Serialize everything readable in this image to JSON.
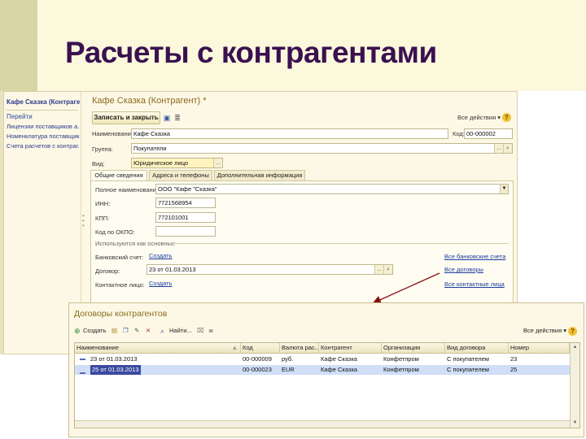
{
  "slide": {
    "title": "Расчеты с контрагентами"
  },
  "nav": {
    "title": "Кафе Сказка (Контрагент)",
    "go_label": "Перейти",
    "links": [
      "Лицензии поставщиков а...",
      "Номенклатура поставщика",
      "Счета расчетов с контраг..."
    ]
  },
  "form": {
    "title": "Кафе Сказка (Контрагент) *",
    "save_close_label": "Записать и закрыть",
    "all_actions_label": "Все действия ▾",
    "help_label": "?",
    "name_label": "Наименование:",
    "name_value": "Кафе Сказка",
    "code_label": "Код:",
    "code_value": "00-000002",
    "group_label": "Группа:",
    "group_value": "Покупатели",
    "kind_label": "Вид:",
    "kind_value": "Юридическое лицо",
    "tabs": [
      "Общие сведения",
      "Адреса и телефоны",
      "Дополнительная информация"
    ],
    "full_name_label": "Полное наименование:",
    "full_name_value": "ООО \"Кафе \"Сказка\"",
    "inn_label": "ИНН:",
    "inn_value": "7721568954",
    "kpp_label": "КПП:",
    "kpp_value": "772101001",
    "okpo_label": "Код по ОКПО:",
    "okpo_value": "",
    "used_as_main_label": "Используются как основные",
    "bank_account_label": "Банковский счет:",
    "bank_account_link": "Создать",
    "contract_label": "Договор:",
    "contract_value": "23  от 01.03.2013",
    "contact_label": "Контактное лицо:",
    "contact_link": "Создать",
    "all_bank_accounts_link": "Все банковские счета",
    "all_contracts_link": "Все договоры",
    "all_contacts_link": "Все контактные лица"
  },
  "contracts": {
    "title": "Договоры контрагентов",
    "create_label": "Создать",
    "find_label": "Найти...",
    "all_actions_label": "Все действия ▾",
    "help_label": "?",
    "columns": [
      "Наименование",
      "Код",
      "Валюта рас...",
      "Контрагент",
      "Организация",
      "Вид договора",
      "Номер"
    ],
    "rows": [
      [
        "23  от 01.03.2013",
        "00-000009",
        "руб.",
        "Кафе Сказка",
        "Конфетпром",
        "С покупателем",
        "23"
      ],
      [
        "25 от 01.03.2013",
        "00-000023",
        "EUR",
        "Кафе Сказка",
        "Конфетпром",
        "С покупателем",
        "25"
      ]
    ]
  },
  "colors": {
    "title": "#3a1150",
    "accent": "#8a6a1a",
    "link": "#1a3aa0",
    "selection": "#3a4aa0"
  }
}
